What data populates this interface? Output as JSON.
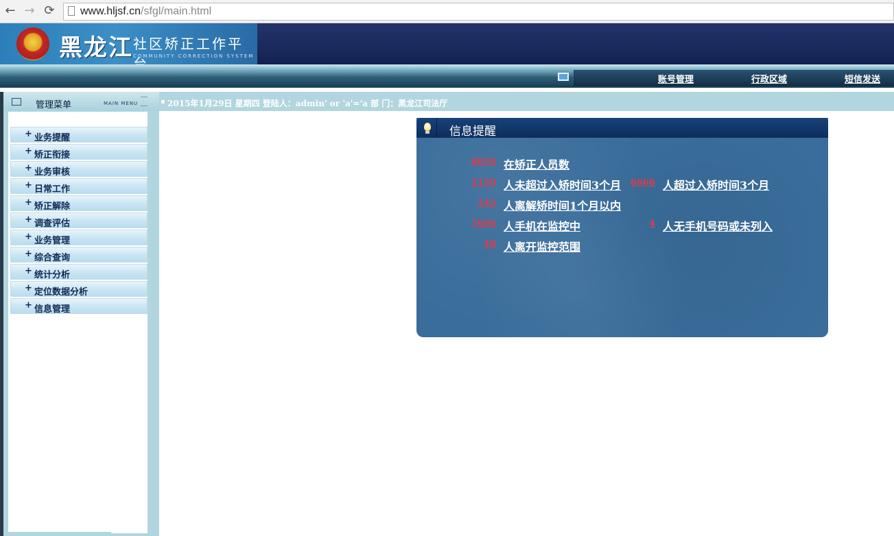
{
  "browser": {
    "back_icon": "←",
    "forward_icon": "→",
    "reload_icon": "⟳",
    "url_host": "www.hljsf.cn",
    "url_path": "/sfgl/main.html"
  },
  "header": {
    "brand": "黑龙江",
    "subtitle": "社区矫正工作平台",
    "subtitle_en": "COMMUNITY CORRECTION SYSTEM"
  },
  "topnav": {
    "items": [
      {
        "label": "账号管理"
      },
      {
        "label": "行政区域"
      },
      {
        "label": "短信发送"
      }
    ]
  },
  "sidebar": {
    "title": "管理菜单",
    "title_en": "MAIN MENU",
    "items": [
      {
        "label": "业务提醒"
      },
      {
        "label": "矫正衔接"
      },
      {
        "label": "业务审核"
      },
      {
        "label": "日常工作"
      },
      {
        "label": "矫正解除"
      },
      {
        "label": "调查评估"
      },
      {
        "label": "业务管理"
      },
      {
        "label": "综合查询"
      },
      {
        "label": "统计分析"
      },
      {
        "label": "定位数据分析"
      },
      {
        "label": "信息管理"
      }
    ],
    "plus": "+"
  },
  "status": {
    "text": "2015年1月29日 星期四 登陆人：admin' or 'a'='a 部 门：黑龙江司法厅"
  },
  "panel": {
    "title": "信息提醒",
    "rows": [
      {
        "num": "8059",
        "text": "在矫正人员数"
      },
      {
        "num": "1150",
        "text": "人未超过入矫时间3个月"
      },
      {
        "num": "6666",
        "text": "人超过入矫时间3个月"
      },
      {
        "num": "343",
        "text": "人离解矫时间1个月以内"
      },
      {
        "num": "7696",
        "text": "人手机在监控中"
      },
      {
        "num": "4",
        "text": "人无手机号码或未列入"
      },
      {
        "num": "48",
        "text": "人离开监控范围"
      }
    ]
  },
  "colors": {
    "header_bg": "#1a2a5c",
    "sidebar_bg": "#b1d6df",
    "panel_bg": "#3a6d9b",
    "number_red": "#e23a46"
  }
}
